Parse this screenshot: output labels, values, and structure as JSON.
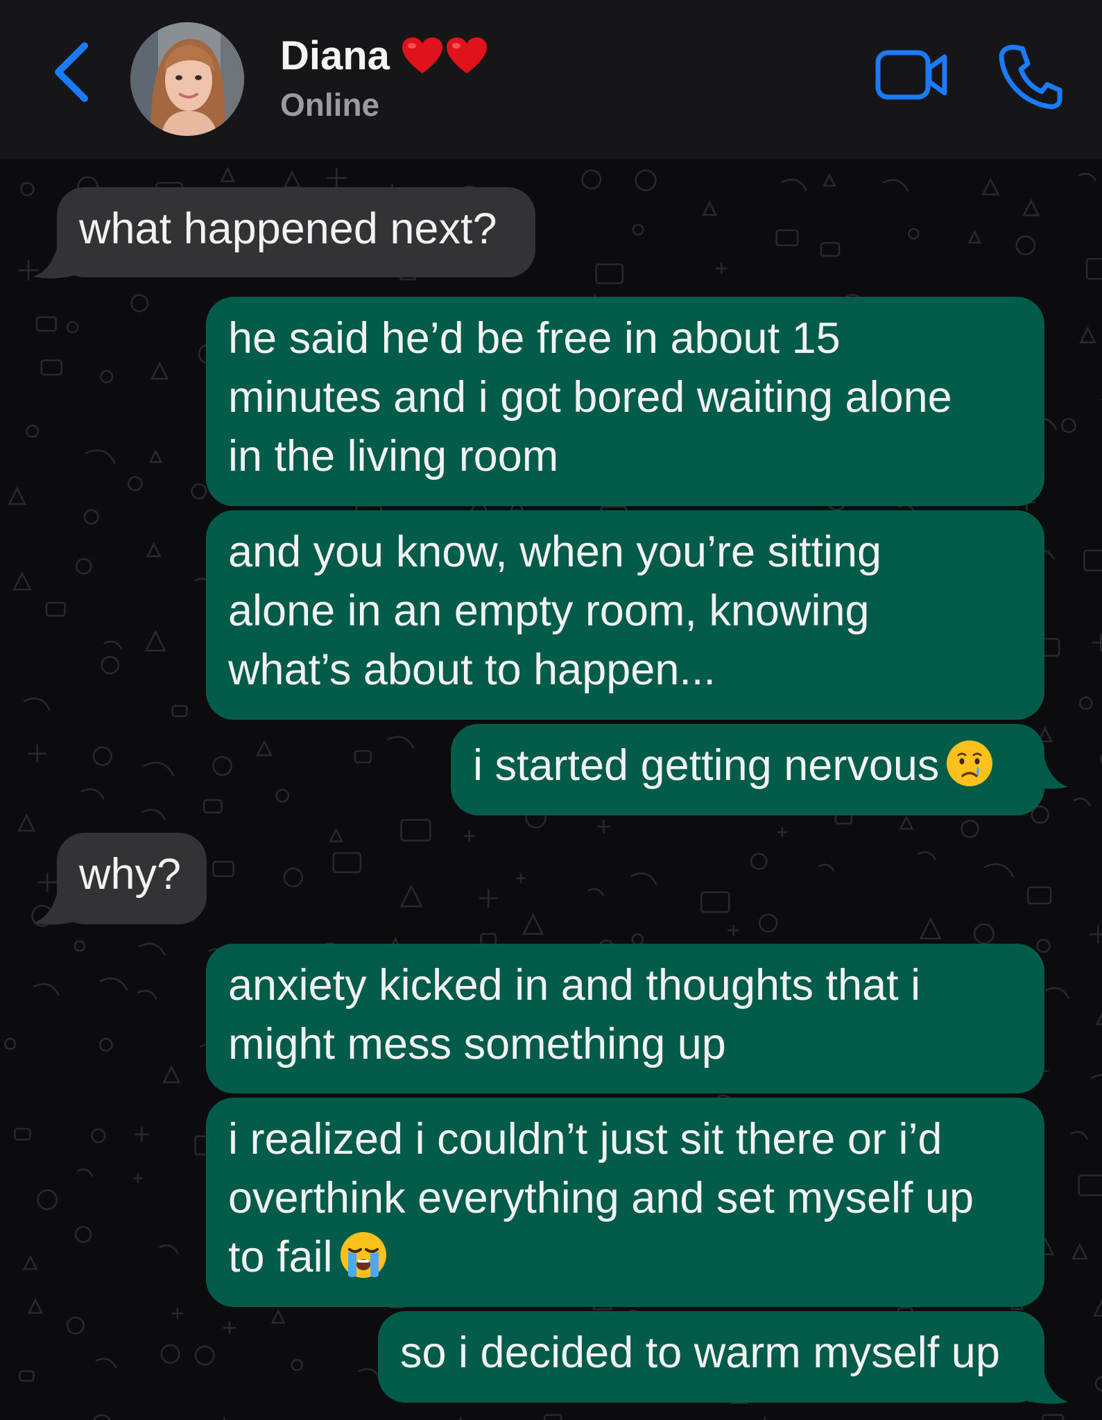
{
  "header": {
    "contact_name": "Diana",
    "contact_status": "Online",
    "back_icon": "chevron-left-icon",
    "video_icon": "video-camera-icon",
    "call_icon": "phone-icon",
    "name_decoration": "red-heart-emoji x2"
  },
  "colors": {
    "header_bg": "#161618",
    "chat_bg": "#0c0c0e",
    "incoming_bubble": "#333335",
    "outgoing_bubble": "#035c4a",
    "accent_blue": "#1a7bff",
    "text": "#f2f2f2",
    "status_text": "#9b9ba0"
  },
  "messages": [
    {
      "direction": "incoming",
      "lines": [
        "what happened next?"
      ]
    },
    {
      "direction": "outgoing",
      "lines": [
        "he said he’d be free in about 15",
        "minutes and i got bored waiting alone",
        "in the living room"
      ]
    },
    {
      "direction": "outgoing",
      "lines": [
        "and you know, when you’re sitting",
        "alone in an empty room, knowing",
        "what’s about to happen..."
      ]
    },
    {
      "direction": "outgoing",
      "lines": [
        "i started getting nervous"
      ],
      "emoji": "crying-face-emoji"
    },
    {
      "direction": "incoming",
      "lines": [
        "why?"
      ]
    },
    {
      "direction": "outgoing",
      "lines": [
        "anxiety kicked in and thoughts that i",
        "might mess something up"
      ]
    },
    {
      "direction": "outgoing",
      "lines": [
        "i realized i couldn’t just sit there or i’d",
        "overthink everything and set myself up",
        "to fail"
      ],
      "emoji": "loudly-crying-face-emoji"
    },
    {
      "direction": "outgoing",
      "lines": [
        "so i decided to warm myself up"
      ]
    }
  ]
}
